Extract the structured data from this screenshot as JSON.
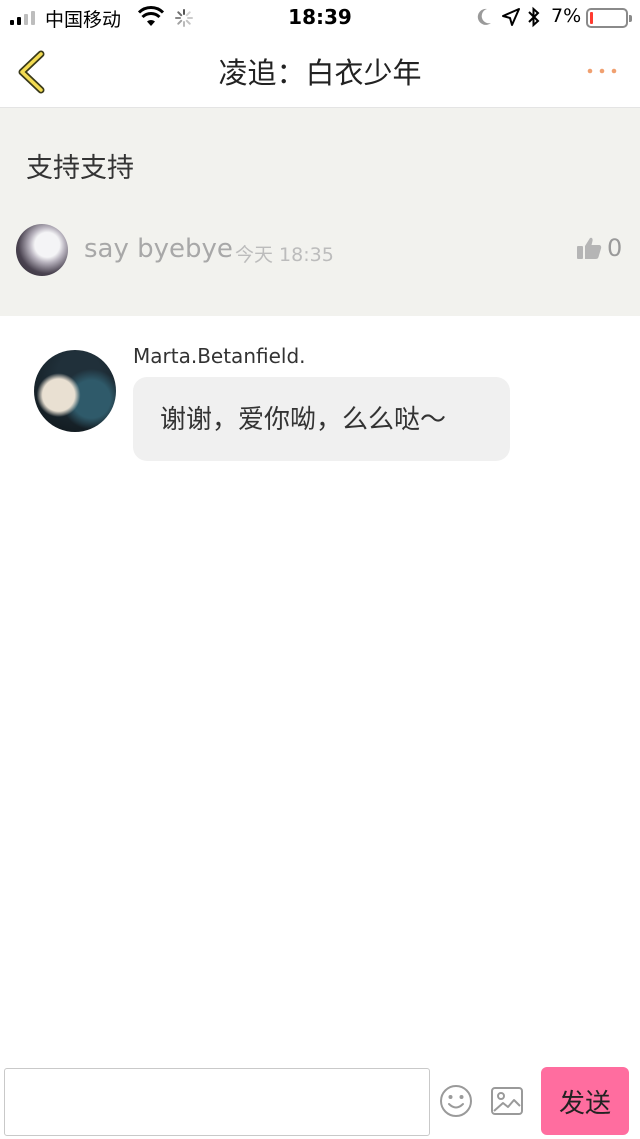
{
  "status_bar": {
    "carrier": "中国移动",
    "time": "18:39",
    "battery_percent": "7%",
    "battery_level": 0.07,
    "battery_color": "#ff3b30"
  },
  "nav": {
    "title": "凌追：白衣少年",
    "back_icon": "chevron-left-icon",
    "more_icon": "more-dots-icon",
    "accent_color": "#f0a070"
  },
  "post": {
    "content": "支持支持",
    "author": "say byebye",
    "time": "今天 18:35",
    "likes": "0"
  },
  "reply": {
    "author": "Marta.Betanfield.",
    "message": "谢谢，爱你呦，么么哒～"
  },
  "input_bar": {
    "placeholder": "",
    "send_label": "发送",
    "send_color": "#ff6d9f"
  }
}
